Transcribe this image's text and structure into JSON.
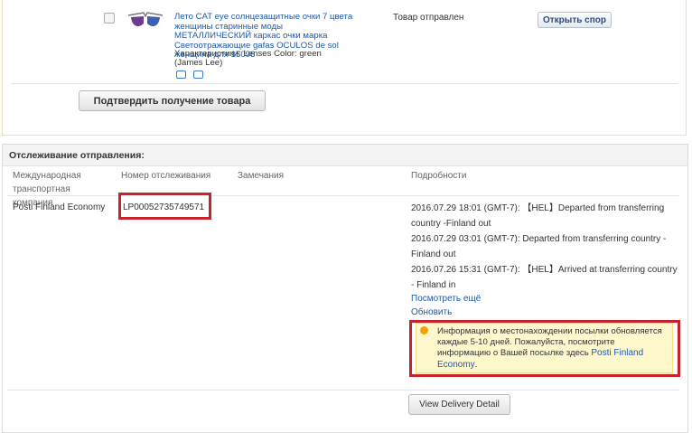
{
  "order": {
    "product_title": "Лето CAT eye солнцезащитные очки 7 цвета женщины старинные моды МЕТАЛЛИЧЕСКИЙ каркас очки марка Светоотражающие gafas OCULOS de sol женщина для 15096",
    "attributes_line1": "Характеристики: Lenses Color: green",
    "attributes_line2": "(James Lee)",
    "status": "Товар отправлен",
    "dispute_button": "Открыть спор",
    "confirm_button": "Подтвердить получение товара"
  },
  "tracking": {
    "title": "Отслеживание отправления:",
    "columns": {
      "carrier": "Международная транспортная компания",
      "number": "Номер отслеживания",
      "remarks": "Замечания",
      "details": "Подробности"
    },
    "carrier": "Posti Finland Economy",
    "number": "LP00052735749571",
    "events": [
      "2016.07.29 18:01 (GMT-7): 【HEL】Departed from transferring country -Finland out",
      "2016.07.29 03:01 (GMT-7): Departed from transferring country - Finland out",
      "2016.07.26 15:31 (GMT-7): 【HEL】Arrived at transferring country - Finland in"
    ],
    "see_more": "Посмотреть ещё",
    "refresh": "Обновить",
    "notice_text": "Информация о местонахождении посылки обновляется каждые 5-10 дней. Пожалуйста, посмотрите информацию о Вашей посылке здесь ",
    "notice_link": "Posti Finland Economy",
    "notice_tail": ".",
    "delivery_button": "View Delivery Detail"
  },
  "colors": {
    "highlight": "#c8232c",
    "link": "#1e5aa8",
    "notice_bg": "#fff8cc"
  }
}
